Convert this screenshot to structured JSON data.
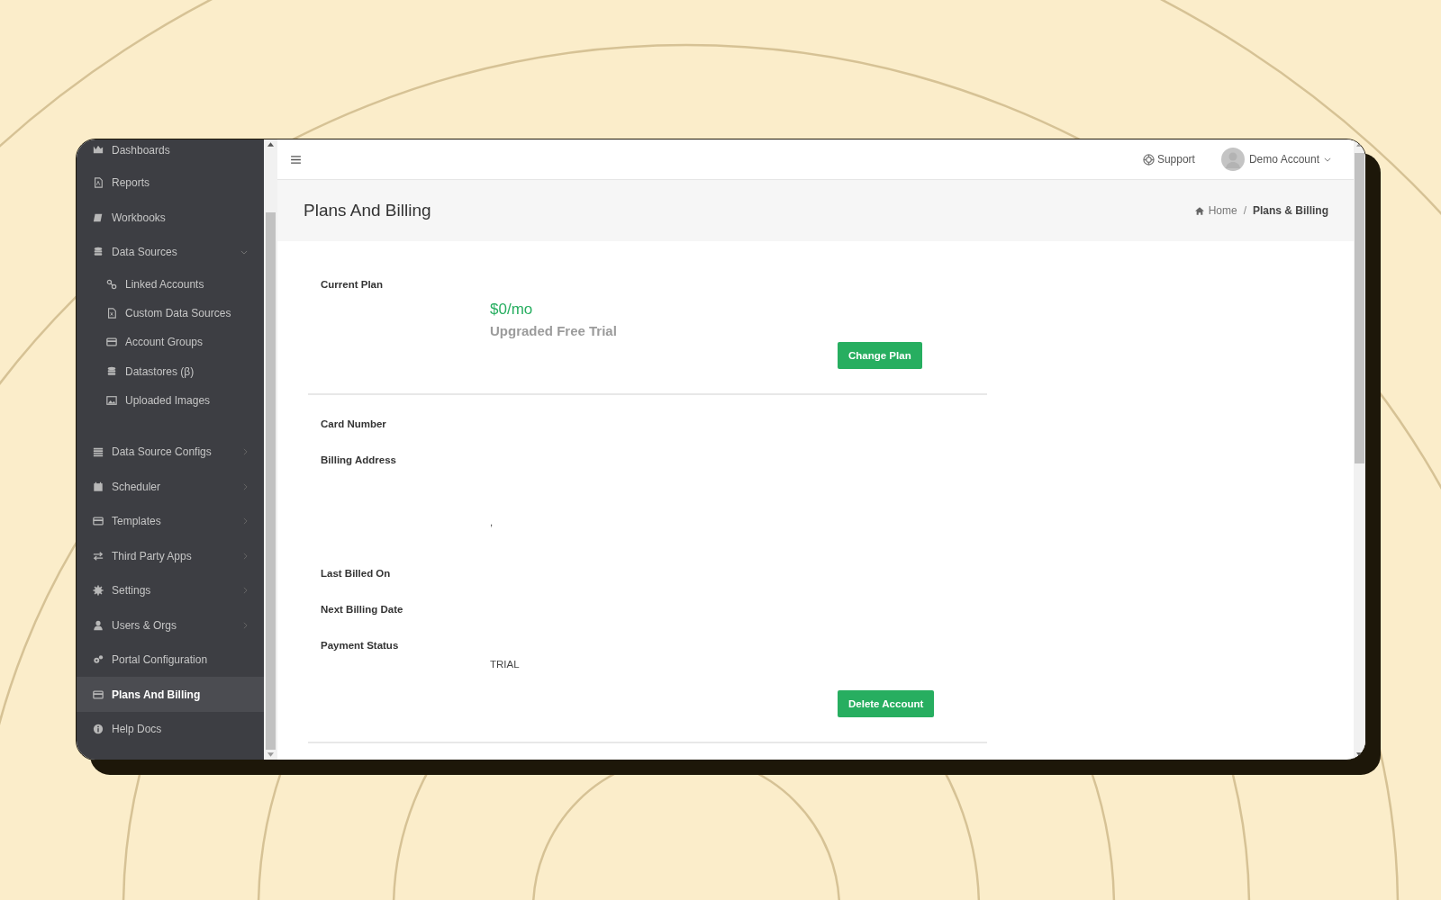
{
  "sidebar": {
    "items": [
      {
        "label": "Dashboards",
        "kind": "link",
        "selected": false
      },
      {
        "label": "Reports",
        "kind": "link",
        "selected": false
      },
      {
        "label": "Workbooks",
        "kind": "link",
        "selected": false
      },
      {
        "label": "Data Sources",
        "kind": "group",
        "expanded": true,
        "selected": false,
        "children": [
          {
            "label": "Linked Accounts",
            "selected": false
          },
          {
            "label": "Custom Data Sources",
            "selected": false
          },
          {
            "label": "Account Groups",
            "selected": false
          },
          {
            "label": "Datastores (β)",
            "selected": false
          },
          {
            "label": "Uploaded Images",
            "selected": false
          }
        ]
      },
      {
        "label": "Data Source Configs",
        "kind": "group",
        "expanded": false,
        "selected": false
      },
      {
        "label": "Scheduler",
        "kind": "group",
        "expanded": false,
        "selected": false
      },
      {
        "label": "Templates",
        "kind": "group",
        "expanded": false,
        "selected": false
      },
      {
        "label": "Third Party Apps",
        "kind": "group",
        "expanded": false,
        "selected": false
      },
      {
        "label": "Settings",
        "kind": "group",
        "expanded": false,
        "selected": false
      },
      {
        "label": "Users & Orgs",
        "kind": "group",
        "expanded": false,
        "selected": false
      },
      {
        "label": "Portal Configuration",
        "kind": "link",
        "selected": false
      },
      {
        "label": "Plans And Billing",
        "kind": "link",
        "selected": true
      },
      {
        "label": "Help Docs",
        "kind": "link",
        "selected": false
      }
    ]
  },
  "topbar": {
    "support": "Support",
    "account": "Demo Account"
  },
  "page_header": {
    "title": "Plans And Billing",
    "separator": "/",
    "breadcrumb": [
      {
        "label": "Home"
      },
      {
        "label": "Plans & Billing"
      }
    ]
  },
  "plan": {
    "label": "Current Plan",
    "price": "$0/mo",
    "name": "Upgraded Free Trial",
    "button": "Change Plan"
  },
  "details": [
    {
      "label": "Card Number"
    },
    {
      "label": "Billing Address",
      "kind": "address",
      "value": ","
    },
    {
      "label": "Last Billed On"
    },
    {
      "label": "Next Billing Date"
    },
    {
      "label": "Payment Status",
      "value": "TRIAL"
    }
  ],
  "delete_button": "Delete Account"
}
